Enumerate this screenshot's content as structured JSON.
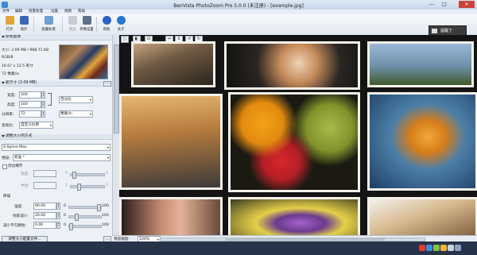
{
  "window": {
    "title": "BenVista PhotoZoom Pro 5.0.0 (未注册) - [example.jpg]",
    "minimize_glyph": "—",
    "maximize_glyph": "□",
    "close_glyph": "✕"
  },
  "menu": [
    "文件",
    "编辑",
    "批量处理",
    "设置",
    "视图",
    "帮助"
  ],
  "toolbar": [
    {
      "label": "打开",
      "icon": "folder-open-icon",
      "color": "#e1a53a"
    },
    {
      "label": "保存",
      "icon": "floppy-disk-icon",
      "color": "#3b67b5"
    },
    {
      "label": "批量处理",
      "icon": "batch-icon",
      "color": "#6a9fd1"
    },
    {
      "label": "预览",
      "icon": "preview-icon",
      "color": "#c9cdd3"
    },
    {
      "label": "参数设置",
      "icon": "tools-icon",
      "color": "#5b6f86"
    },
    {
      "label": "帮助",
      "icon": "help-icon",
      "color": "#2a62c2"
    },
    {
      "label": "关于",
      "icon": "info-icon",
      "color": "#2a78d0"
    }
  ],
  "promo": {
    "label": "提醒了"
  },
  "left_panel": {
    "original": {
      "header": "原始图像",
      "size": "大小: 3.09 MB / 988.71 KB",
      "mode": "RGB/8",
      "dimensions": "16.67 x 12.5 英寸",
      "resolution": "72 像素/in"
    },
    "new_size": {
      "header": "新尺寸 (3.09 MB)",
      "width_label": "宽度:",
      "width_value": "100",
      "height_label": "高度:",
      "height_value": "100",
      "unit_value": "百分比",
      "resolution_label": "分辨率:",
      "resolution_value": "72",
      "res_unit_value": "像素/in",
      "preset_label": "宽高比:",
      "preset_value": "自定义比例"
    },
    "method": {
      "header": "调整大小的方式",
      "algorithm": "S-Spline Max",
      "preset_label": "预设:",
      "preset_value": "标准 *",
      "optimize_label": "优化细节",
      "sharpness_label": "锐度:",
      "sharpness_value": "0",
      "sharpness_max": "5",
      "clarity_label": "半径:",
      "clarity_value": "1",
      "clarity_max": "1",
      "noise_header": "降噪",
      "strength_label": "强度:",
      "strength_value": "90.00",
      "strength_min": "0",
      "strength_max": "100",
      "artifact_label": "伪影减少:",
      "artifact_value": "20.00",
      "artifact_min": "0",
      "artifact_max": "100",
      "grain_label": "减少不匀颗粒:",
      "grain_value": "0.00",
      "grain_min": "0",
      "grain_max": "100"
    },
    "bottom_button": "调整大小配置文件..."
  },
  "status": {
    "zoom_label": "预览缩放:",
    "zoom_value": "100%"
  }
}
